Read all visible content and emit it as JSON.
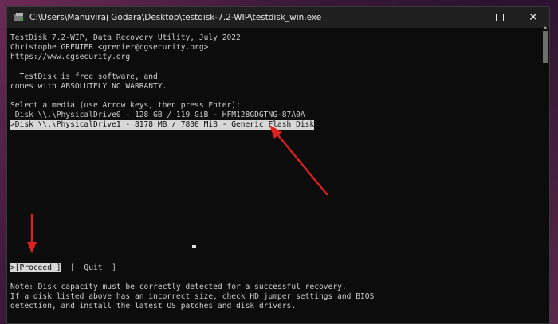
{
  "window": {
    "title": "C:\\Users\\Manuviraj Godara\\Desktop\\testdisk-7.2-WIP\\testdisk_win.exe"
  },
  "console": {
    "lines": [
      "TestDisk 7.2-WIP, Data Recovery Utility, July 2022",
      "Christophe GRENIER <grenier@cgsecurity.org>",
      "https://www.cgsecurity.org",
      "",
      "  TestDisk is free software, and",
      "comes with ABSOLUTELY NO WARRANTY.",
      "",
      "Select a media (use Arrow keys, then press Enter):"
    ],
    "disks": [
      " Disk \\\\.\\PhysicalDrive0 - 128 GB / 119 GiB - HFM128GDGTNG-87A0A",
      ">Disk \\\\.\\PhysicalDrive1 - 8178 MB / 7800 MiB - Generic Flash Disk"
    ],
    "menu": {
      "proceed": ">[Proceed ]",
      "quit": "  [  Quit  ]"
    },
    "notes": [
      "Note: Disk capacity must be correctly detected for a successful recovery.",
      "If a disk listed above has an incorrect size, check HD jumper settings and BIOS",
      "detection, and install the latest OS patches and disk drivers."
    ]
  },
  "colors": {
    "annotation_arrow": "#e02020",
    "terminal_bg": "#0c0c0c",
    "terminal_fg": "#cccccc",
    "highlight_bg": "#d8d8d8"
  }
}
